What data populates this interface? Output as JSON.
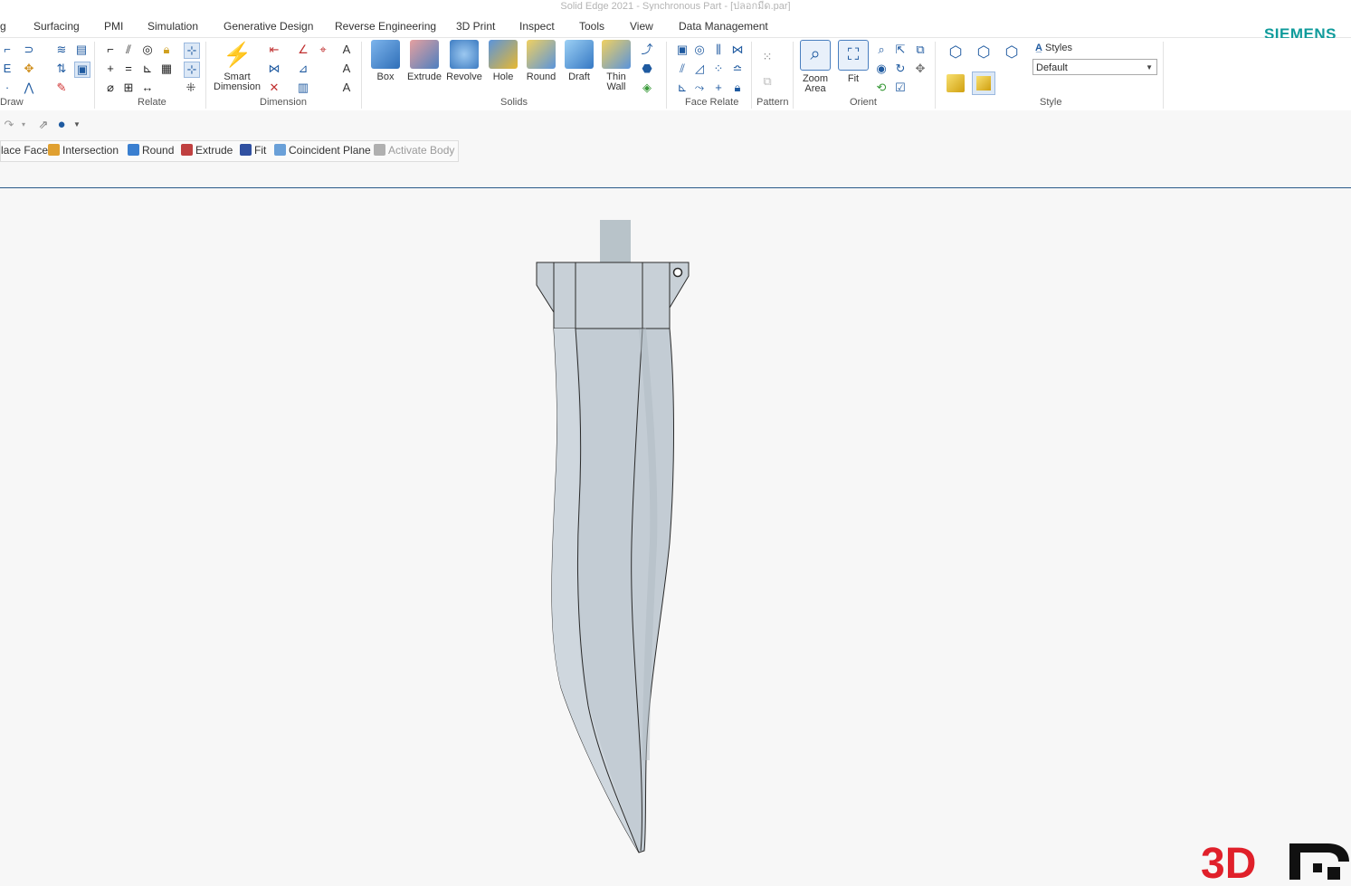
{
  "window": {
    "title": "Solid Edge 2021 - Synchronous Part - [ปลอกมีด.par]"
  },
  "brand": "SIEMENS",
  "menu_tabs": [
    "g",
    "Surfacing",
    "PMI",
    "Simulation",
    "Generative Design",
    "Reverse Engineering",
    "3D Print",
    "Inspect",
    "Tools",
    "View",
    "Data Management"
  ],
  "ribbon": {
    "groups": {
      "draw": "Draw",
      "relate": "Relate",
      "dimension": "Dimension",
      "solids": "Solids",
      "face_relate": "Face Relate",
      "pattern": "Pattern",
      "orient": "Orient",
      "style": "Style"
    },
    "buttons": {
      "smart_dimension": "Smart\nDimension",
      "box": "Box",
      "extrude": "Extrude",
      "revolve": "Revolve",
      "hole": "Hole",
      "round": "Round",
      "draft": "Draft",
      "thin_wall": "Thin\nWall",
      "zoom_area": "Zoom\nArea",
      "fit": "Fit"
    },
    "styles": {
      "label": "Styles",
      "selected": "Default"
    }
  },
  "command_bar": {
    "items": [
      {
        "label": "lace Face",
        "color": "#4a8bd0",
        "disabled": false
      },
      {
        "label": "Intersection",
        "color": "#e0a030",
        "disabled": false
      },
      {
        "label": "Round",
        "color": "#3a7fd0",
        "disabled": false
      },
      {
        "label": "Extrude",
        "color": "#c04040",
        "disabled": false
      },
      {
        "label": "Fit",
        "color": "#3050a0",
        "disabled": false
      },
      {
        "label": "Coincident Plane",
        "color": "#6aa0d8",
        "disabled": false
      },
      {
        "label": "Activate Body",
        "color": "#b0b0b0",
        "disabled": true
      }
    ]
  },
  "model": {
    "part": "knife sheath",
    "fill_color": "#c3ccd4",
    "edge_color": "#2a2a2a"
  },
  "watermark": {
    "text": "3D",
    "color": "#e0202a"
  }
}
